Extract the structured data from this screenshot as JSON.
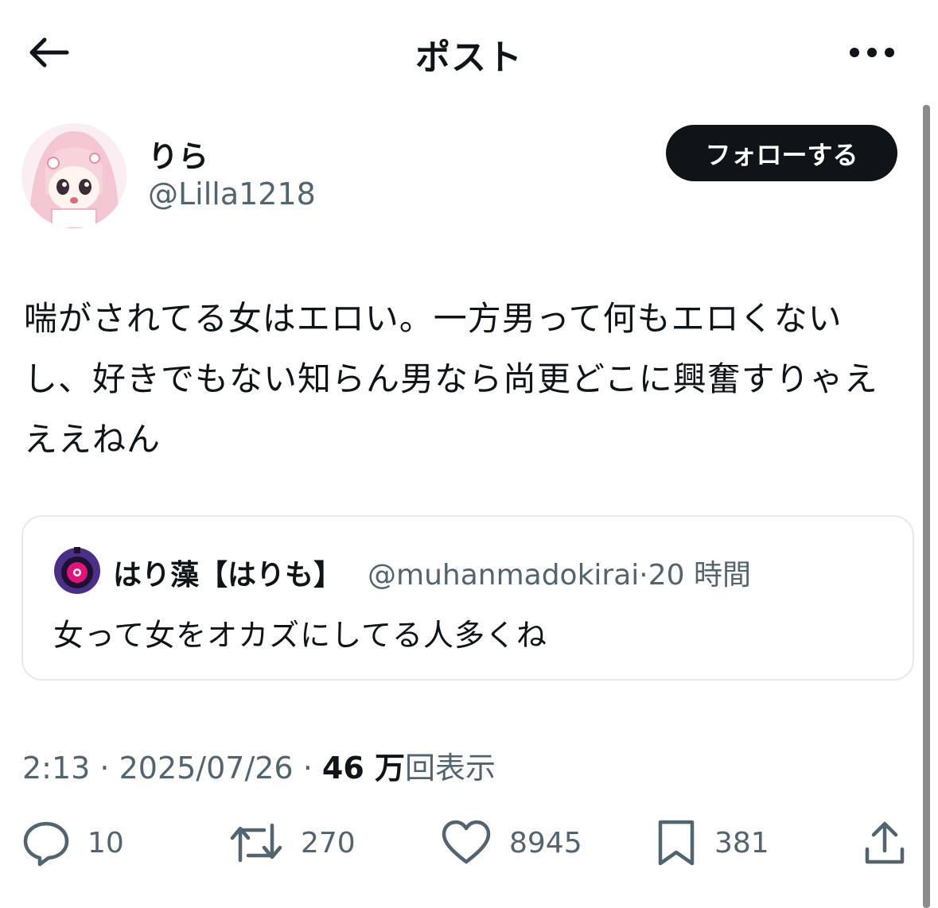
{
  "header": {
    "title": "ポスト",
    "back_icon": "arrow-left-icon",
    "more_icon": "more-horizontal-icon"
  },
  "author": {
    "name": "りら",
    "handle": "@Lilla1218",
    "follow_label": "フォローする"
  },
  "post": {
    "text": "喘がされてる女はエロい。一方男って何もエロくないし、好きでもない知らん男なら尚更どこに興奮すりゃえええねん"
  },
  "quote": {
    "name": "はり藻【はりも】",
    "handle": "@muhanmadokirai",
    "separator": "·",
    "time": "20 時間",
    "text": "女って女をオカズにしてる人多くね"
  },
  "meta": {
    "time": "2:13",
    "sep1": " · ",
    "date": "2025/07/26",
    "sep2": " · ",
    "views_count": "46 万",
    "views_label": "回表示"
  },
  "actions": {
    "replies": "10",
    "reposts": "270",
    "likes": "8945",
    "bookmarks": "381"
  },
  "colors": {
    "text": "#0f1419",
    "secondary": "#536471",
    "border": "#e6e9eb",
    "button_bg": "#0f1419"
  }
}
